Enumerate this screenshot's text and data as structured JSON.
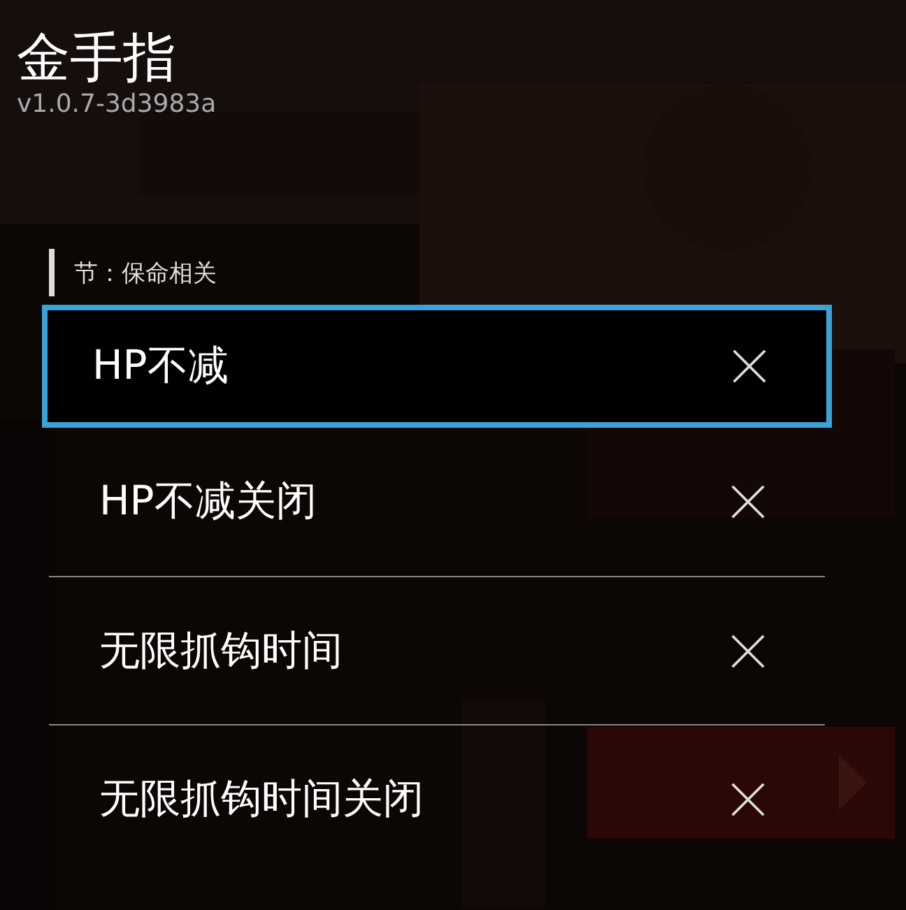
{
  "header": {
    "title": "金手指",
    "version": "v1.0.7-3d3983a"
  },
  "section": {
    "label": "节：保命相关"
  },
  "cheats": [
    {
      "label": "HP不减",
      "enabled": false,
      "selected": true
    },
    {
      "label": "HP不减关闭",
      "enabled": false,
      "selected": false
    },
    {
      "label": "无限抓钩时间",
      "enabled": false,
      "selected": false
    },
    {
      "label": "无限抓钩时间关闭",
      "enabled": false,
      "selected": false
    }
  ]
}
